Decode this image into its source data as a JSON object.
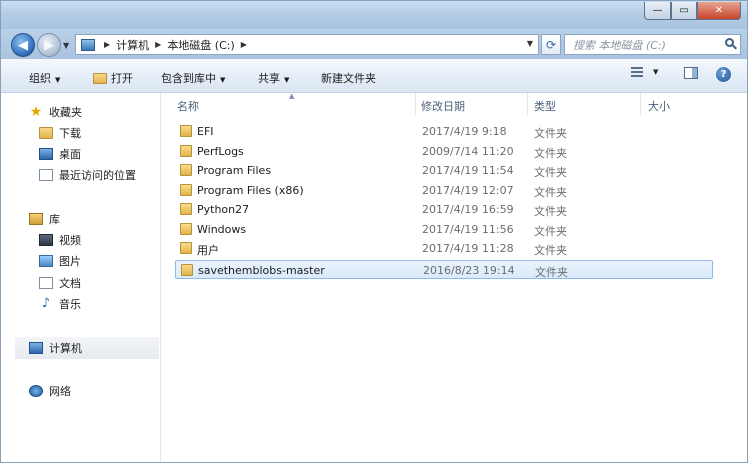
{
  "window": {
    "controls": {
      "minimize": "—",
      "maximize": "▭",
      "close": "✕"
    }
  },
  "nav": {
    "back_icon": "back-arrow-icon",
    "forward_icon": "forward-arrow-icon",
    "breadcrumb": [
      "计算机",
      "本地磁盘 (C:)"
    ],
    "search_placeholder": "搜索 本地磁盘 (C:)"
  },
  "toolbar": {
    "organize": "组织",
    "open": "打开",
    "include_in_library": "包含到库中",
    "share": "共享",
    "new_folder": "新建文件夹"
  },
  "sidebar": {
    "favorites": {
      "label": "收藏夹",
      "items": [
        "下载",
        "桌面",
        "最近访问的位置"
      ]
    },
    "libraries": {
      "label": "库",
      "items": [
        "视频",
        "图片",
        "文档",
        "音乐"
      ]
    },
    "computer": "计算机",
    "network": "网络"
  },
  "columns": {
    "name": "名称",
    "modified": "修改日期",
    "type": "类型",
    "size": "大小"
  },
  "files": [
    {
      "name": "EFI",
      "modified": "2017/4/19 9:18",
      "type": "文件夹"
    },
    {
      "name": "PerfLogs",
      "modified": "2009/7/14 11:20",
      "type": "文件夹"
    },
    {
      "name": "Program Files",
      "modified": "2017/4/19 11:54",
      "type": "文件夹"
    },
    {
      "name": "Program Files (x86)",
      "modified": "2017/4/19 12:07",
      "type": "文件夹"
    },
    {
      "name": "Python27",
      "modified": "2017/4/19 16:59",
      "type": "文件夹"
    },
    {
      "name": "Windows",
      "modified": "2017/4/19 11:56",
      "type": "文件夹"
    },
    {
      "name": "用户",
      "modified": "2017/4/19 11:28",
      "type": "文件夹"
    },
    {
      "name": "savethemblobs-master",
      "modified": "2016/8/23 19:14",
      "type": "文件夹",
      "selected": true
    }
  ],
  "colors": {
    "selection_border": "#8fb9e8",
    "selection_fill": "#d9eafb",
    "folder": "#e2b34a"
  }
}
